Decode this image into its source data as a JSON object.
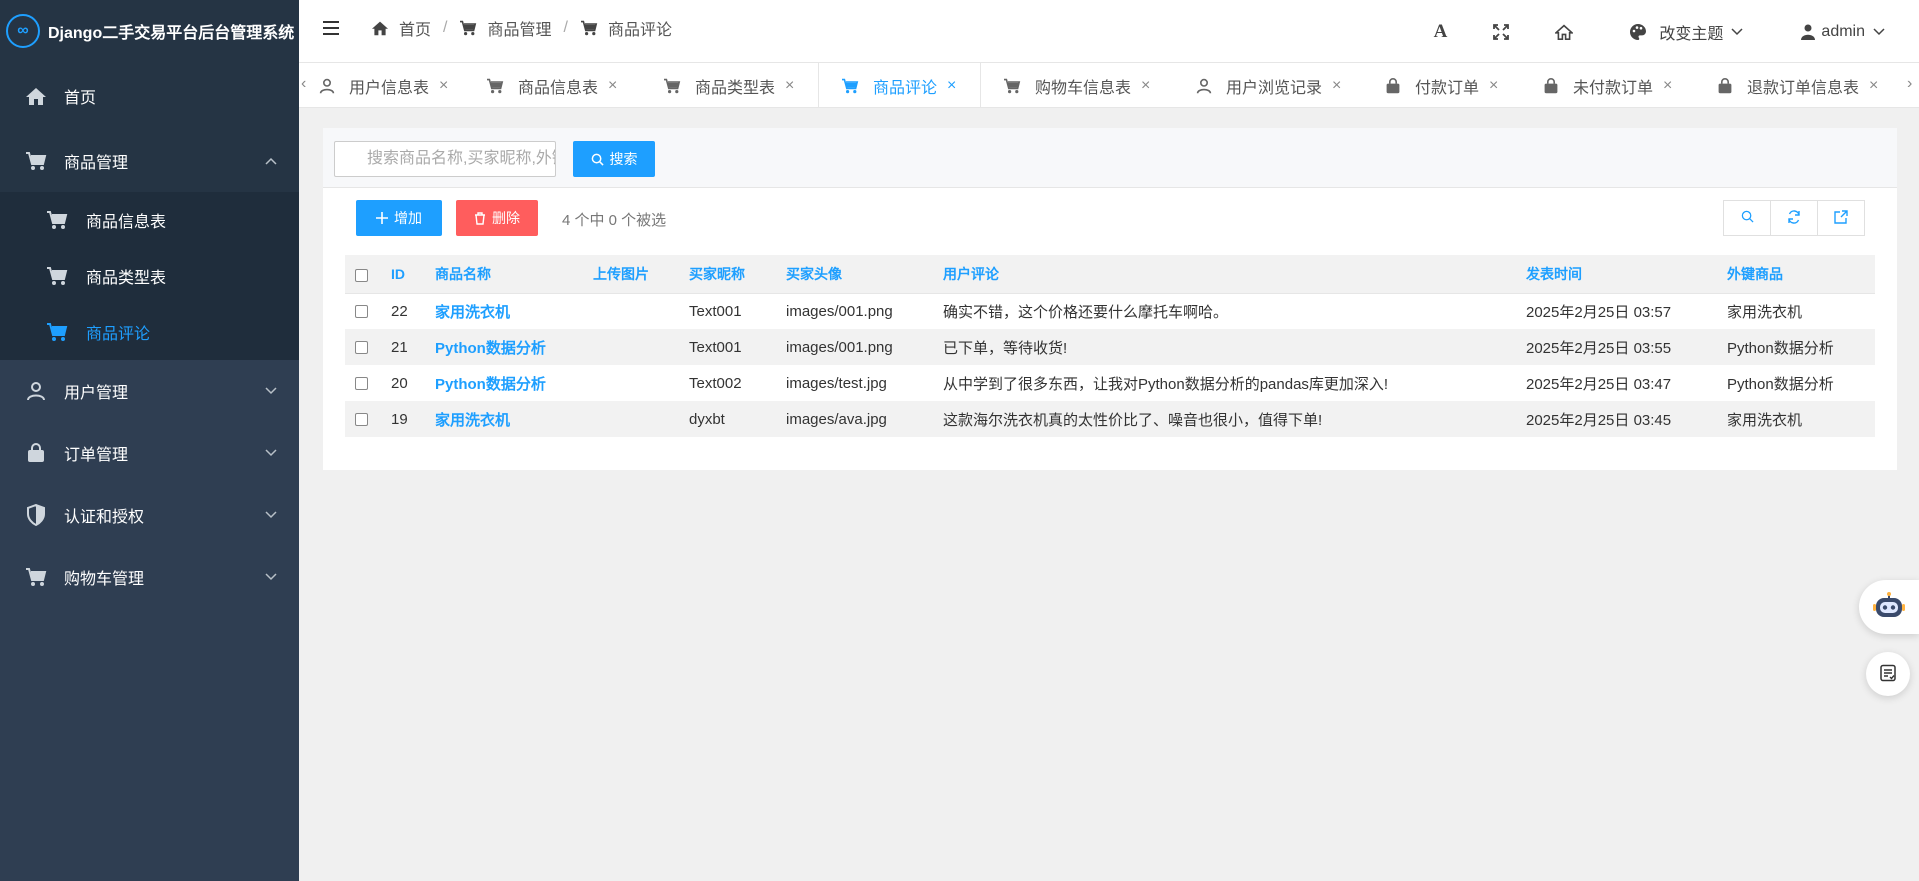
{
  "app": {
    "title": "Django二手交易平台后台管理系统",
    "logo_glyph": "∞"
  },
  "sidebar": {
    "items": [
      {
        "label": "首页",
        "icon": "home-icon"
      },
      {
        "label": "商品管理",
        "icon": "cart-icon",
        "expanded": true,
        "children": [
          {
            "label": "商品信息表",
            "icon": "cart-icon"
          },
          {
            "label": "商品类型表",
            "icon": "cart-icon"
          },
          {
            "label": "商品评论",
            "icon": "cart-icon",
            "active": true
          }
        ]
      },
      {
        "label": "用户管理",
        "icon": "user-icon"
      },
      {
        "label": "订单管理",
        "icon": "bag-icon"
      },
      {
        "label": "认证和授权",
        "icon": "shield-icon"
      },
      {
        "label": "购物车管理",
        "icon": "cart-icon"
      }
    ]
  },
  "breadcrumb": {
    "items": [
      "首页",
      "商品管理",
      "商品评论"
    ],
    "separator": "/"
  },
  "topbar": {
    "theme_label": "改变主题",
    "user_label": "admin",
    "font_glyph": "A"
  },
  "tabs": [
    {
      "label": "用户信息表",
      "icon": "user-icon"
    },
    {
      "label": "商品信息表",
      "icon": "cart-icon"
    },
    {
      "label": "商品类型表",
      "icon": "cart-icon"
    },
    {
      "label": "商品评论",
      "icon": "cart-icon",
      "active": true
    },
    {
      "label": "购物车信息表",
      "icon": "cart-icon"
    },
    {
      "label": "用户浏览记录",
      "icon": "user-icon"
    },
    {
      "label": "付款订单",
      "icon": "bag-icon"
    },
    {
      "label": "未付款订单",
      "icon": "bag-icon"
    },
    {
      "label": "退款订单信息表",
      "icon": "bag-icon"
    }
  ],
  "tab_close_glyph": "×",
  "tab_prev_glyph": "‹",
  "tab_next_glyph": "›",
  "search": {
    "placeholder": "搜索商品名称,买家昵称,外键商品",
    "button_label": "搜索"
  },
  "actions": {
    "add_label": "增加",
    "delete_label": "删除",
    "selection_text": "4 个中 0 个被选"
  },
  "table": {
    "columns": [
      "ID",
      "商品名称",
      "上传图片",
      "买家昵称",
      "买家头像",
      "用户评论",
      "发表时间",
      "外键商品"
    ],
    "rows": [
      {
        "id": "22",
        "name": "家用洗衣机",
        "image": "",
        "buyer": "Text001",
        "avatar": "images/001.png",
        "comment": "确实不错，这个价格还要什么摩托车啊哈。",
        "time": "2025年2月25日 03:57",
        "product": "家用洗衣机"
      },
      {
        "id": "21",
        "name": "Python数据分析",
        "image": "",
        "buyer": "Text001",
        "avatar": "images/001.png",
        "comment": "已下单，等待收货!",
        "time": "2025年2月25日 03:55",
        "product": "Python数据分析"
      },
      {
        "id": "20",
        "name": "Python数据分析",
        "image": "",
        "buyer": "Text002",
        "avatar": "images/test.jpg",
        "comment": "从中学到了很多东西，让我对Python数据分析的pandas库更加深入!",
        "time": "2025年2月25日 03:47",
        "product": "Python数据分析"
      },
      {
        "id": "19",
        "name": "家用洗衣机",
        "image": "",
        "buyer": "dyxbt",
        "avatar": "images/ava.jpg",
        "comment": "这款海尔洗衣机真的太性价比了、噪音也很小，值得下单!",
        "time": "2025年2月25日 03:45",
        "product": "家用洗衣机"
      }
    ]
  },
  "colors": {
    "accent": "#1e9fff",
    "danger": "#ff5d5d",
    "sidebar": "#2f3e52",
    "sidebar_dark": "#253444"
  }
}
